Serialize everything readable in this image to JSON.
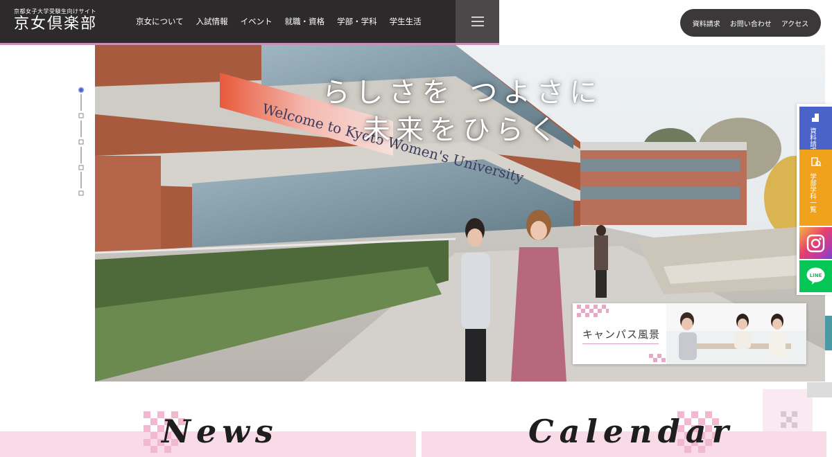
{
  "header": {
    "logo_sub": "京都女子大学受験生向けサイト",
    "logo_main": "京女倶楽部",
    "nav": [
      "京女について",
      "入試情報",
      "イベント",
      "就職・資格",
      "学部・学科",
      "学生生活"
    ]
  },
  "utility_nav": [
    "資料請求",
    "お問い合わせ",
    "アクセス"
  ],
  "hero": {
    "catch_line1": "らしさを つよさに",
    "catch_line2": "未来をひらく",
    "banner_text": "Welcome to Kyoto Women's University",
    "card_label": "キャンパス風景"
  },
  "side_tabs": {
    "request": "資料請求",
    "departments": "学部学科一覧"
  },
  "sections": {
    "news": "News",
    "calendar": "Calendar"
  },
  "colors": {
    "header_bg": "#2c2a2b",
    "accent_pink": "#c98fb4",
    "band_pink": "#f8dbe7",
    "tab_blue": "#4a63c9",
    "tab_orange": "#f0a21d",
    "line_green": "#06c755"
  },
  "icons": {
    "menu": "hamburger-icon",
    "request": "document-icon",
    "departments": "building-search-icon",
    "instagram": "instagram-icon",
    "line": "line-icon"
  }
}
